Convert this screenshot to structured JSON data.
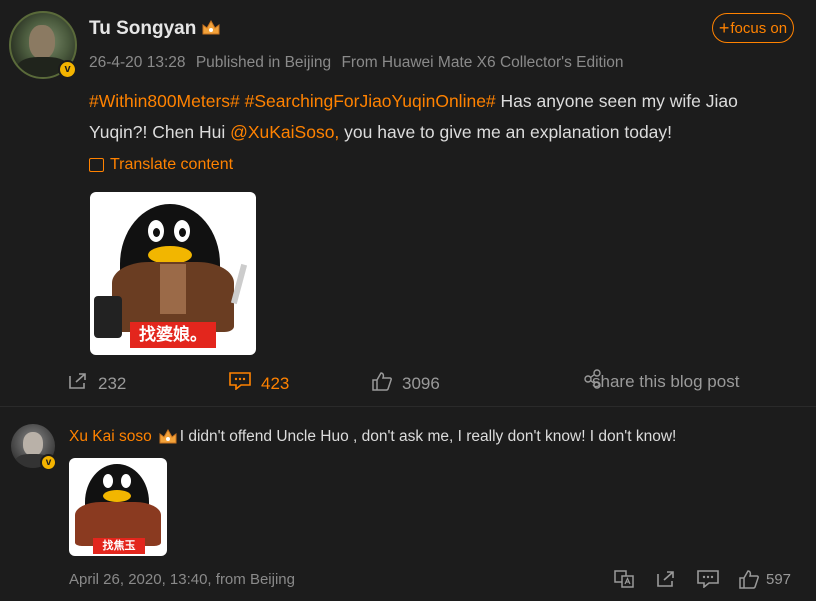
{
  "post": {
    "author": "Tu Songyan",
    "follow_label": "focus on",
    "meta": {
      "date": "26-4-20 13:28",
      "published": "Published in Beijing",
      "device": "From Huawei Mate X6 Collector's Edition"
    },
    "content": {
      "hashtag1": "#Within800Meters#",
      "hashtag2": "#SearchingForJiaoYuqinOnline#",
      "text1": " Has anyone seen my wife Jiao Yuqin?! Chen Hui ",
      "mention": "@XuKaiSoso,",
      "text2": " you have to give me an explanation today!"
    },
    "translate_label": "Translate content",
    "image_caption": "找婆娘。",
    "actions": {
      "share_count": "232",
      "comment_count": "423",
      "like_count": "3096",
      "share_blog_label": "share this blog post"
    }
  },
  "comment": {
    "author": "Xu Kai soso",
    "text": " I didn't offend Uncle Huo , don't ask me, I really don't know! I don't know!",
    "image_caption": "找焦玉芹。",
    "footer": "April 26, 2020, 13:40, from Beijing",
    "like_count": "597"
  },
  "colors": {
    "accent": "#ff8200",
    "background": "#1c1c1c",
    "verified": "#f4b400"
  },
  "icons": [
    "verified-badge-icon",
    "crown-icon",
    "plus-icon",
    "translate-icon",
    "share-icon",
    "comment-icon",
    "like-icon",
    "share-link-icon",
    "translate-comment-icon",
    "forward-icon",
    "reply-icon"
  ]
}
